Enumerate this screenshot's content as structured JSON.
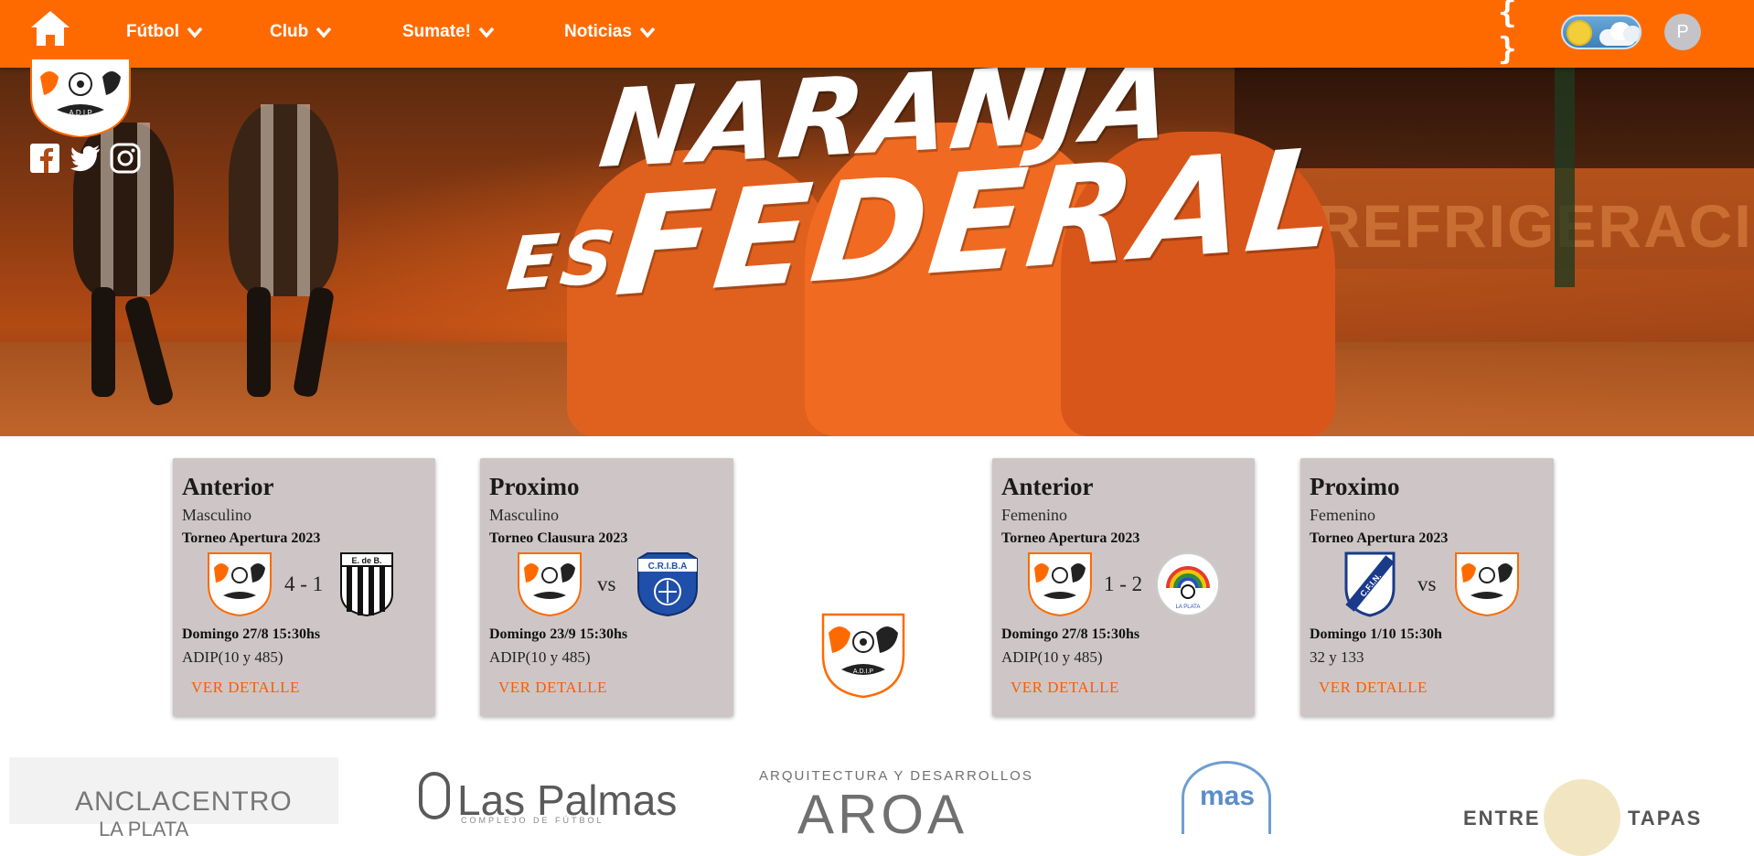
{
  "nav": {
    "items": [
      {
        "label": "Fútbol"
      },
      {
        "label": "Club"
      },
      {
        "label": "Sumate!"
      },
      {
        "label": "Noticias"
      }
    ],
    "code_icon": "{ }",
    "avatar_initial": "P"
  },
  "hero": {
    "line1": "NARANJA",
    "line2_es": "ES",
    "line2": "FEDERAL",
    "background_text": "REFRIGERACIO  AGRO"
  },
  "cards": [
    {
      "title": "Anterior",
      "category": "Masculino",
      "tournament": "Torneo Apertura 2023",
      "home_crest": "ADIP",
      "away_crest": "E. de B.",
      "score": "4 - 1",
      "date": "Domingo 27/8 15:30hs",
      "venue": "ADIP(10 y 485)",
      "detail_label": "VER DETALLE"
    },
    {
      "title": "Proximo",
      "category": "Masculino",
      "tournament": "Torneo Clausura 2023",
      "home_crest": "ADIP",
      "away_crest": "C.R.I.B.A",
      "score": "vs",
      "date": "Domingo 23/9 15:30hs",
      "venue": "ADIP(10 y 485)",
      "detail_label": "VER DETALLE"
    },
    {
      "title": "Anterior",
      "category": "Femenino",
      "tournament": "Torneo Apertura 2023",
      "home_crest": "ADIP",
      "away_crest": "LA PLATA",
      "score": "1 - 2",
      "date": "Domingo 27/8 15:30hs",
      "venue": "ADIP(10 y 485)",
      "detail_label": "VER DETALLE"
    },
    {
      "title": "Proximo",
      "category": "Femenino",
      "tournament": "Torneo Apertura 2023",
      "home_crest": "C.F.I.N.",
      "away_crest": "ADIP",
      "score": "vs",
      "date": "Domingo 1/10 15:30h",
      "venue": "32 y 133",
      "detail_label": "VER DETALLE"
    }
  ],
  "logo_text": "A.D.I.P",
  "sponsors": {
    "s1_line1": "ANCLACENTRO",
    "s1_line2": "LA PLATA",
    "s2": "Las Palmas",
    "s2_sub": "COMPLEJO DE FÚTBOL",
    "s3_top": "ARQUITECTURA Y DESARROLLOS",
    "s3": "AROA",
    "s4": "mas",
    "s5a": "ENTRE",
    "s5b": "TAPAS"
  },
  "colors": {
    "primary": "#ff6a00",
    "card_bg": "#cec6c6",
    "link": "#ff5a00"
  }
}
